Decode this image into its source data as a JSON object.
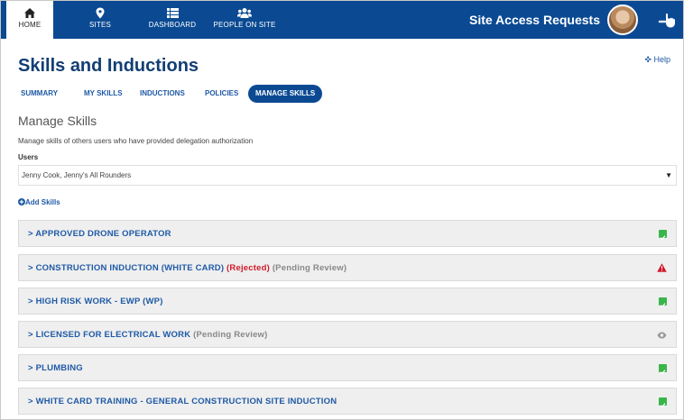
{
  "nav": {
    "items": [
      {
        "label": "HOME",
        "icon": "home-icon"
      },
      {
        "label": "SITES",
        "icon": "map-pin-icon"
      },
      {
        "label": "DASHBOARD",
        "icon": "list-icon"
      },
      {
        "label": "PEOPLE ON SITE",
        "icon": "people-icon"
      }
    ],
    "site_title": "Site Access Requests"
  },
  "page": {
    "title": "Skills and Inductions",
    "help": "Help",
    "tabs": [
      "SUMMARY",
      "MY SKILLS",
      "INDUCTIONS",
      "POLICIES",
      "MANAGE SKILLS"
    ],
    "active_tab": "MANAGE SKILLS"
  },
  "manage": {
    "title": "Manage Skills",
    "description": "Manage skills of others users who have provided delegation authorization",
    "users_label": "Users",
    "users_value": "Jenny Cook, Jenny's All Rounders",
    "add_skills": "Add Skills"
  },
  "skills": [
    {
      "name": "APPROVED DRONE OPERATOR",
      "rejected": "",
      "pending": "",
      "status": "approved"
    },
    {
      "name": "CONSTRUCTION INDUCTION (WHITE CARD)",
      "rejected": "(Rejected)",
      "pending": "(Pending Review)",
      "status": "rejected"
    },
    {
      "name": "HIGH RISK WORK - EWP (WP)",
      "rejected": "",
      "pending": "",
      "status": "approved"
    },
    {
      "name": "LICENSED FOR ELECTRICAL WORK",
      "rejected": "",
      "pending": "(Pending Review)",
      "status": "pending"
    },
    {
      "name": "PLUMBING",
      "rejected": "",
      "pending": "",
      "status": "approved"
    },
    {
      "name": "WHITE CARD TRAINING - GENERAL CONSTRUCTION SITE INDUCTION",
      "rejected": "",
      "pending": "",
      "status": "approved"
    }
  ],
  "colors": {
    "brand": "#0b4a93",
    "link": "#1f5aa6",
    "rejected": "#d11a2a",
    "approved": "#3ab54a"
  }
}
